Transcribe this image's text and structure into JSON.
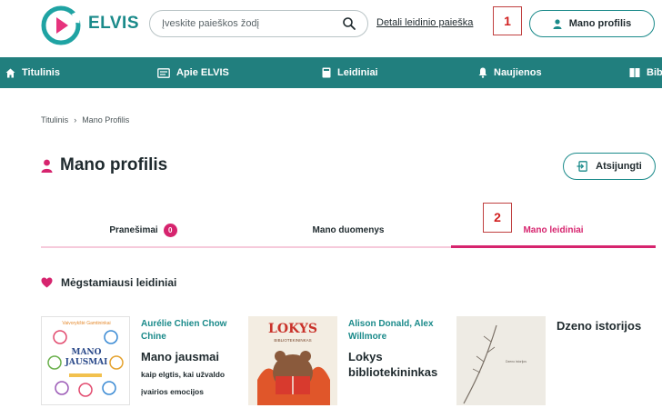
{
  "header": {
    "logo_text": "ELVIS",
    "search": {
      "placeholder": "Įveskite paieškos žodį",
      "value": ""
    },
    "advanced_search_label": "Detali leidinio paieška",
    "annotation_1": "1",
    "profile_button_label": "Mano profilis"
  },
  "nav": {
    "items": [
      {
        "label": "Titulinis",
        "icon": "home-icon"
      },
      {
        "label": "Apie ELVIS",
        "icon": "info-card-icon"
      },
      {
        "label": "Leidiniai",
        "icon": "book-icon"
      },
      {
        "label": "Naujienos",
        "icon": "bell-icon"
      },
      {
        "label": "Bibl",
        "icon": "library-icon"
      }
    ]
  },
  "breadcrumb": {
    "home": "Titulinis",
    "separator": "›",
    "current": "Mano Profilis"
  },
  "page": {
    "title": "Mano profilis",
    "logout_label": "Atsijungti"
  },
  "tabs": {
    "items": [
      {
        "label": "Pranešimai",
        "badge": "0"
      },
      {
        "label": "Mano duomenys"
      },
      {
        "label": "Mano leidiniai",
        "active": true
      }
    ],
    "annotation_2": "2"
  },
  "favorites": {
    "heading": "Mėgstamiausi leidiniai",
    "books": [
      {
        "author": "Aurélie Chien Chow Chine",
        "title": "Mano jausmai",
        "subtitle": "kaip elgtis, kai užvaldo įvairios emocijos",
        "cover_text": "MANO JAUSMAI",
        "cover_top_text": "Vaivorykštė Gamtininkai"
      },
      {
        "author": "Alison Donald,  Alex Willmore",
        "title": "Lokys bibliotekininkas",
        "cover_text": "LOKYS",
        "cover_sub_text": "BIBLIOTEKININKAS"
      },
      {
        "author": "",
        "title": "Dzeno istorijos",
        "cover_text": "Dzeno istorijos"
      }
    ]
  },
  "colors": {
    "teal": "#217f7e",
    "accent_pink": "#d6246e",
    "annotation_red": "#d12020"
  }
}
